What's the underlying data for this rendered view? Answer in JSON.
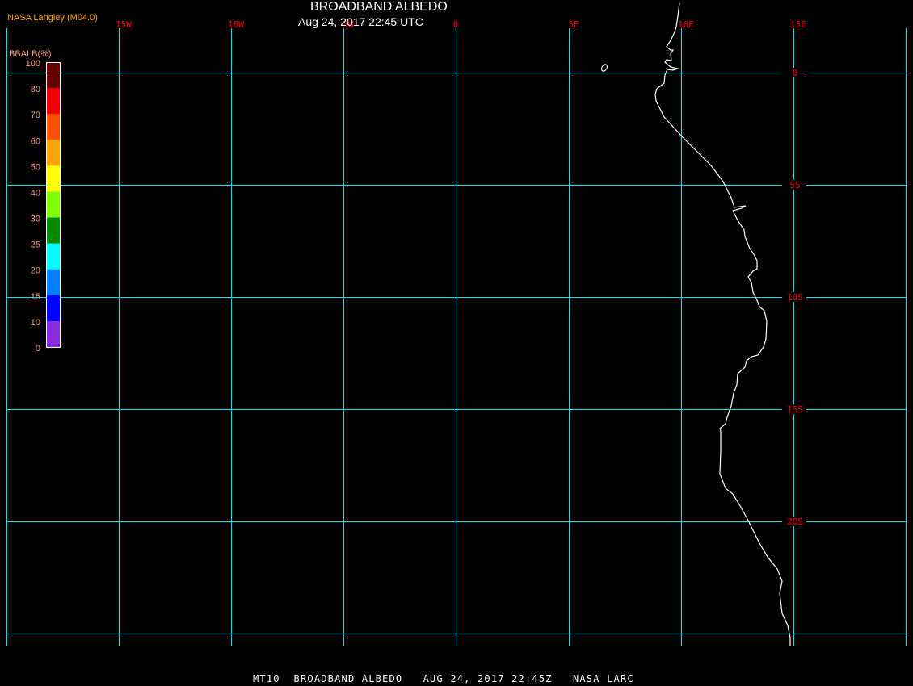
{
  "title": "BROADBAND ALBEDO",
  "subtitle": "Aug 24, 2017 22:45 UTC",
  "credit": "NASA Langley (M04.0)",
  "footer": "MT10  BROADBAND ALBEDO   AUG 24, 2017 22:45Z   NASA LARC",
  "colorbar": {
    "title": "BBALB(%)",
    "tick_labels": [
      "100",
      "80",
      "70",
      "60",
      "50",
      "40",
      "30",
      "25",
      "20",
      "15",
      "10",
      "0"
    ],
    "colors": [
      "#660000",
      "#f00000",
      "#ff5000",
      "#ffa500",
      "#ffff00",
      "#80ff00",
      "#008c00",
      "#00ffff",
      "#0080ff",
      "#0000ff",
      "#8a2be2"
    ]
  },
  "grid": {
    "color": "#00e5ee",
    "label_color": "#ff0000",
    "lon_labels": [
      "15W",
      "10W",
      "5W",
      "0",
      "5E",
      "10E",
      "15E"
    ],
    "lat_labels": [
      "0",
      "5S",
      "10S",
      "15S",
      "20S"
    ]
  },
  "coastline_color": "#ffffff"
}
